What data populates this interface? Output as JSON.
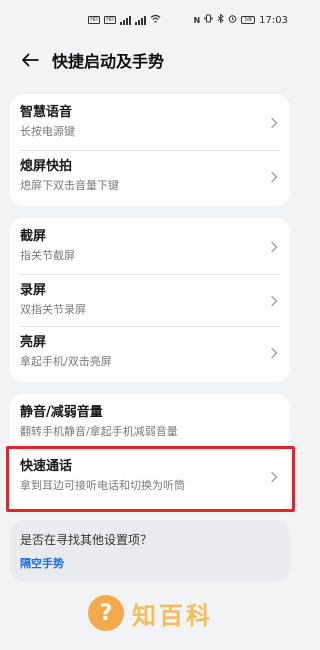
{
  "status": {
    "left_icons": [
      "box-icon",
      "box-icon",
      "signal-icon",
      "signal-icon",
      "wifi-icon"
    ],
    "right_icons": [
      "nfc-icon",
      "vibrate-icon",
      "bluetooth-icon",
      "alarm-icon"
    ],
    "battery": "58",
    "time": "17:03"
  },
  "header": {
    "title": "快捷启动及手势"
  },
  "groups": [
    {
      "items": [
        {
          "title": "智慧语音",
          "sub": "长按电源键"
        },
        {
          "title": "熄屏快拍",
          "sub": "熄屏下双击音量下键"
        }
      ]
    },
    {
      "items": [
        {
          "title": "截屏",
          "sub": "指关节截屏"
        },
        {
          "title": "录屏",
          "sub": "双指关节录屏"
        },
        {
          "title": "亮屏",
          "sub": "拿起手机/双击亮屏"
        }
      ]
    },
    {
      "items": [
        {
          "title": "静音/减弱音量",
          "sub": "翻转手机静音/拿起手机减弱音量"
        },
        {
          "title": "快速通话",
          "sub": "拿到耳边可接听电话和切换为听筒"
        }
      ]
    }
  ],
  "suggest": {
    "question": "是否在寻找其他设置项？",
    "link": "隔空手势"
  },
  "watermark": {
    "text": "知百科",
    "icon": "question-mark-circle-icon"
  },
  "colors": {
    "highlight": "#e0252b",
    "link": "#1a6ee6",
    "background": "#f1f3f5"
  }
}
